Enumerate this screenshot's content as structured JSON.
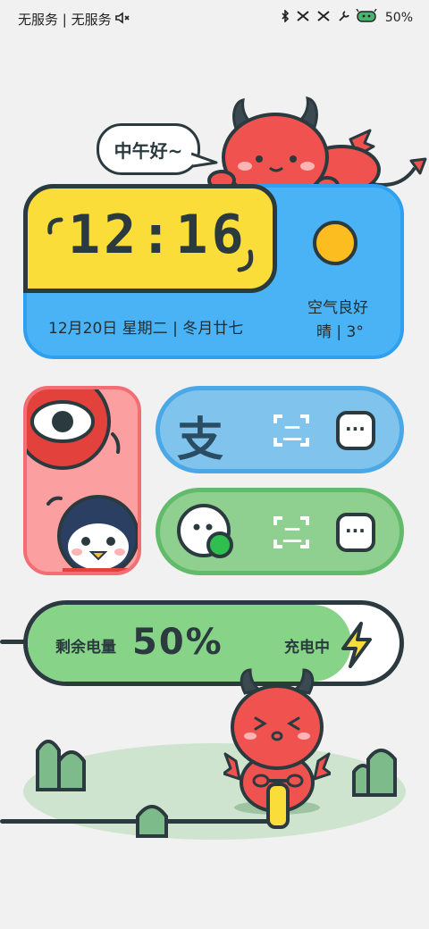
{
  "status_bar": {
    "carrier": "无服务 | 无服务",
    "battery": "50%"
  },
  "greeting": "中午好~",
  "clock": {
    "time": "12:16",
    "date": "12月20日 星期二 | 冬月廿七",
    "air_quality": "空气良好",
    "weather": "晴 | 3°"
  },
  "apps": {
    "alipay_glyph": "支",
    "alipay_scan": "二",
    "alipay_pay": "···",
    "wechat_scan": "二",
    "wechat_pay": "···"
  },
  "battery": {
    "label": "剩余电量",
    "percent": "50%",
    "level": 0.5,
    "charging": "充电中"
  },
  "colors": {
    "outline": "#2b3a3e",
    "clock_yellow": "#fbdd3a",
    "clock_blue": "#49b3f6",
    "pink": "#fc9fa1",
    "alipay_blue": "#80c4ee",
    "wechat_green": "#8fcf8f",
    "battery_green": "#87d387",
    "devil_red": "#f0524f"
  }
}
